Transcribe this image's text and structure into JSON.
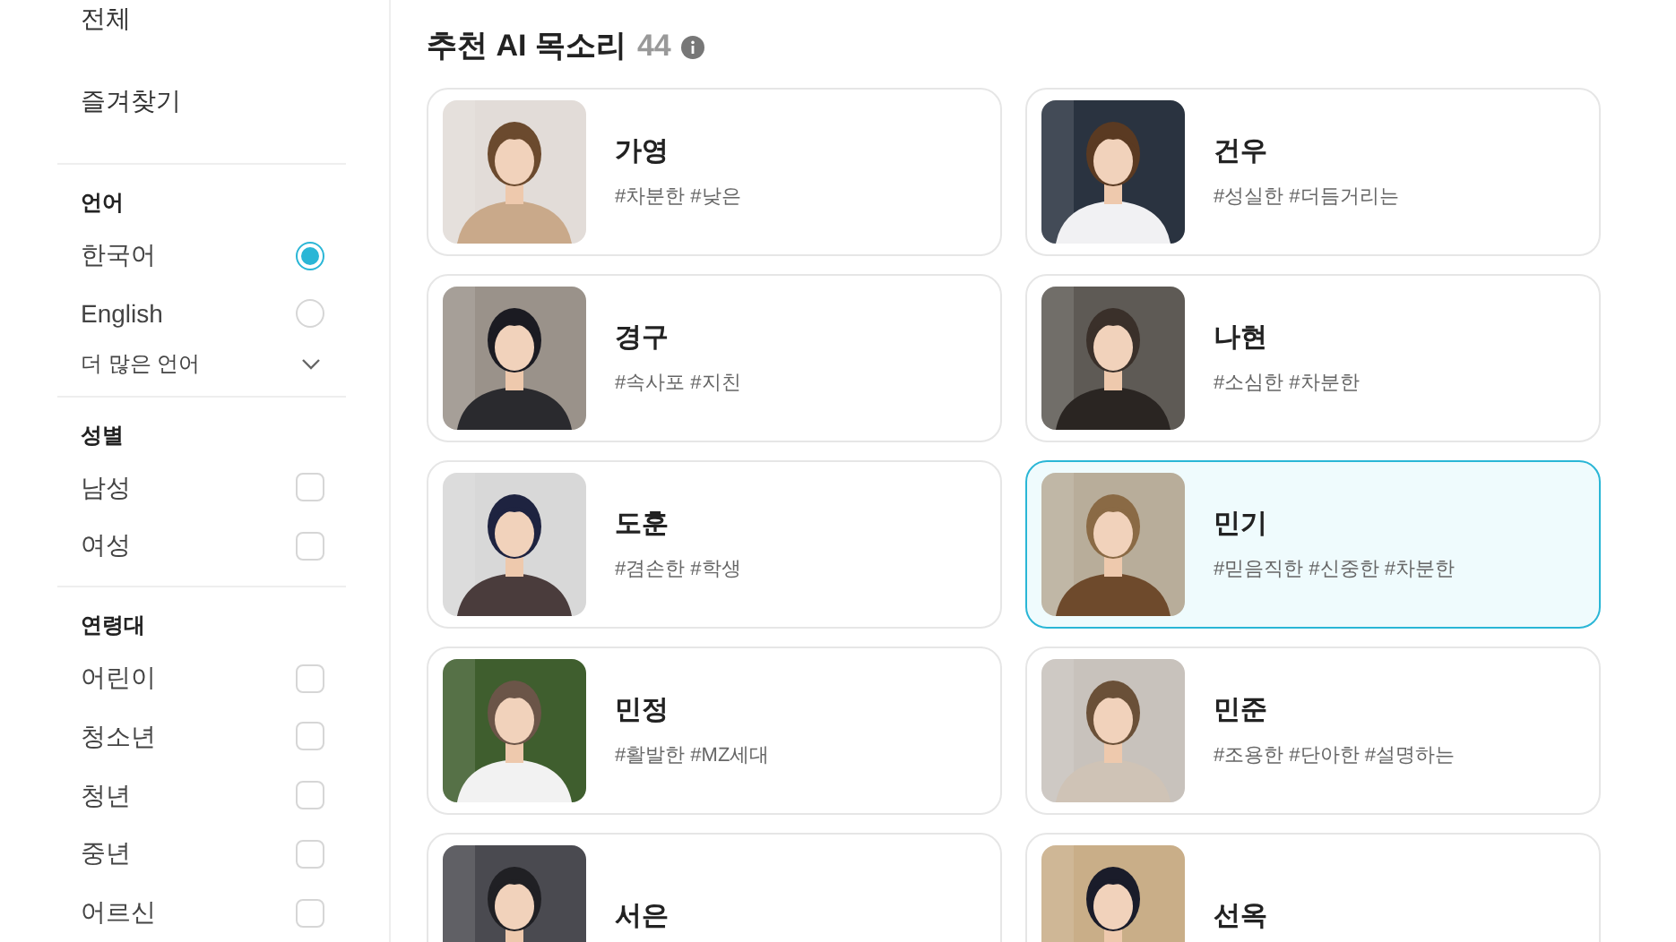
{
  "sidebar": {
    "top_items": [
      {
        "label": "전체"
      },
      {
        "label": "즐겨찾기"
      }
    ],
    "sections": [
      {
        "title": "언어",
        "kind": "radio",
        "options": [
          {
            "label": "한국어",
            "selected": true
          },
          {
            "label": "English",
            "selected": false
          }
        ],
        "more": "더 많은 언어"
      },
      {
        "title": "성별",
        "kind": "checkbox",
        "options": [
          {
            "label": "남성",
            "checked": false
          },
          {
            "label": "여성",
            "checked": false
          }
        ]
      },
      {
        "title": "연령대",
        "kind": "checkbox",
        "options": [
          {
            "label": "어린이",
            "checked": false
          },
          {
            "label": "청소년",
            "checked": false
          },
          {
            "label": "청년",
            "checked": false
          },
          {
            "label": "중년",
            "checked": false
          },
          {
            "label": "어르신",
            "checked": false
          }
        ]
      }
    ]
  },
  "main": {
    "title": "추천 AI 목소리",
    "count": "44",
    "voices": [
      {
        "name": "가영",
        "tags": "#차분한 #낮은",
        "selected": false
      },
      {
        "name": "건우",
        "tags": "#성실한 #더듬거리는",
        "selected": false
      },
      {
        "name": "경구",
        "tags": "#속사포 #지친",
        "selected": false
      },
      {
        "name": "나현",
        "tags": "#소심한 #차분한",
        "selected": false
      },
      {
        "name": "도훈",
        "tags": "#겸손한 #학생",
        "selected": false
      },
      {
        "name": "민기",
        "tags": "#믿음직한 #신중한 #차분한",
        "selected": true
      },
      {
        "name": "민정",
        "tags": "#활발한 #MZ세대",
        "selected": false
      },
      {
        "name": "민준",
        "tags": "#조용한 #단아한 #설명하는",
        "selected": false
      },
      {
        "name": "서은",
        "selected": false
      },
      {
        "name": "선옥",
        "selected": false
      }
    ]
  }
}
